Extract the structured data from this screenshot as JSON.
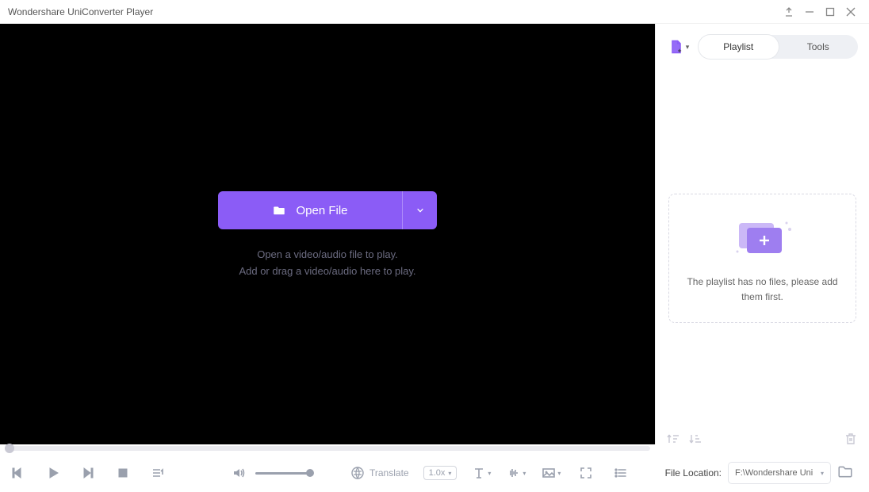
{
  "window": {
    "title": "Wondershare UniConverter Player"
  },
  "player": {
    "open_label": "Open File",
    "hint1": "Open a video/audio file to play.",
    "hint2": "Add or drag a video/audio here to play."
  },
  "side": {
    "tabs": {
      "playlist": "Playlist",
      "tools": "Tools",
      "active": "playlist"
    },
    "empty_text": "The playlist has no files, please add them first."
  },
  "transport": {
    "translate_label": "Translate",
    "speed_label": "1.0x"
  },
  "footer": {
    "file_location_label": "File Location:",
    "file_location_value": "F:\\Wondershare Uni"
  }
}
